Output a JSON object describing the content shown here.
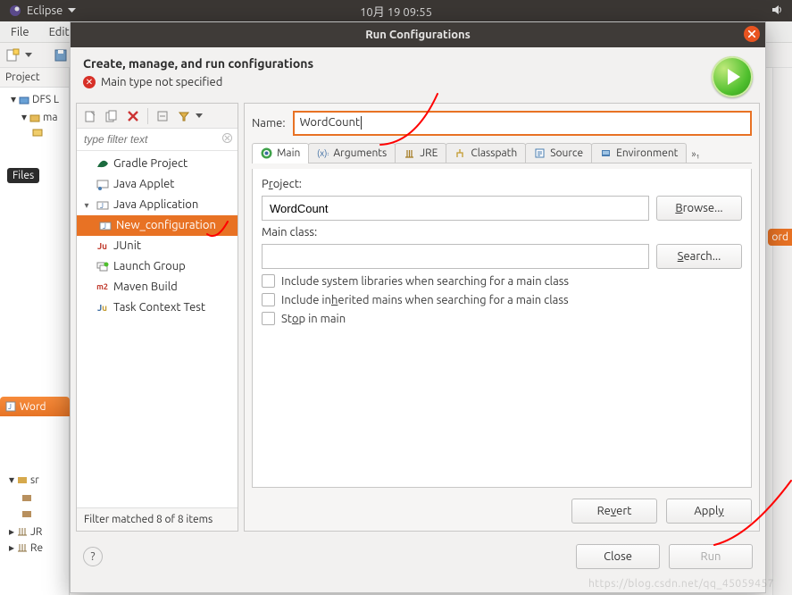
{
  "topbar": {
    "app_label": "Eclipse",
    "time": "10月 19  09:55"
  },
  "menubar": {
    "file": "File",
    "edit": "Edit"
  },
  "project_pane": {
    "header": "Project",
    "dfs_label": "DFS L",
    "ma_label": "ma"
  },
  "bottom_tabs": {
    "word": "Word",
    "src": "sr",
    "jr": "JR",
    "re": "Re"
  },
  "files_tooltip": "Files",
  "peek_tab": "ord",
  "dialog": {
    "title": "Run Configurations",
    "heading": "Create, manage, and run configurations",
    "error": "Main type not specified",
    "tree_toolbar": {},
    "filter_placeholder": "type filter text",
    "tree": {
      "gradle": "Gradle Project",
      "applet": "Java Applet",
      "javaapp": "Java Application",
      "new_config": "New_configuration",
      "junit": "JUnit",
      "launch_group": "Launch Group",
      "maven": "Maven Build",
      "task_context": "Task Context Test"
    },
    "filter_status": "Filter matched 8 of 8 items",
    "name_label": "Name:",
    "name_value": "WordCount",
    "tabs": {
      "main": "Main",
      "arguments": "Arguments",
      "jre": "JRE",
      "classpath": "Classpath",
      "source": "Source",
      "environment": "Environment",
      "more": "»₁"
    },
    "main_tab": {
      "project_label": "Project:",
      "project_value": "WordCount",
      "browse": "Browse...",
      "main_class_label": "Main class:",
      "main_class_value": "",
      "search": "Search...",
      "chk_syslib": "Include system libraries when searching for a main class",
      "chk_inherited": "Include inherited mains when searching for a main class",
      "chk_stop": "Stop in main"
    },
    "buttons": {
      "revert": "Revert",
      "apply": "Apply",
      "close": "Close",
      "run": "Run"
    }
  },
  "watermark": "https://blog.csdn.net/qq_45059457"
}
